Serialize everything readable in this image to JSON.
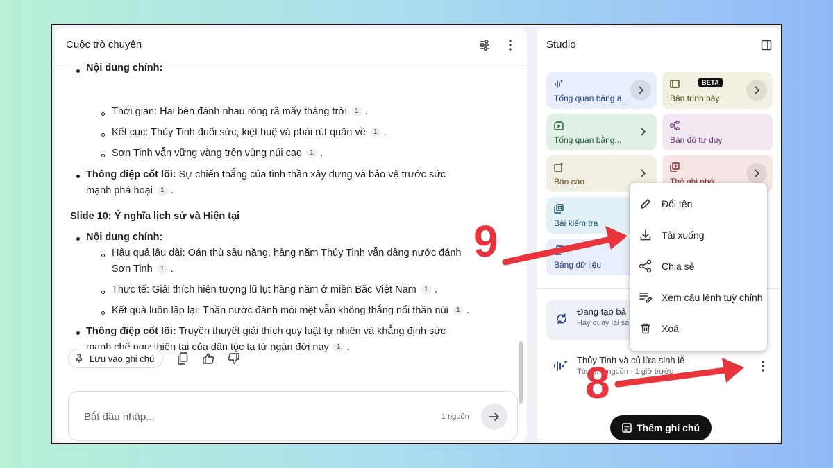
{
  "chat": {
    "title": "Cuộc trò chuyện",
    "lines": {
      "section_partial": "Nội dung chính:",
      "time": "Thời gian: Hai bên đánh nhau ròng rã mấy tháng trời",
      "outcome": "Kết cục: Thủy Tinh đuối sức, kiệt huệ và phải rút quân về",
      "son_tinh": "Sơn Tinh vẫn vững vàng trên vùng núi cao",
      "core_msg_label": "Thông điệp cốt lõi:",
      "core_msg_1": " Sự chiến thắng của tinh thần xây dựng và bảo vệ trước sức",
      "core_msg_1b": "mạnh phá hoại",
      "slide10": "Slide 10: Ý nghĩa lịch sử và Hiện tại",
      "content_label": "Nội dung chính:",
      "consequence": "Hậu quả lâu dài: Oán thù sâu nặng, hàng năm Thủy Tinh vẫn dâng nước đánh",
      "consequence_b": "Sơn Tinh",
      "reality": "Thực tế: Giải thích hiện tượng lũ lụt hàng năm ở miền Bắc Việt Nam",
      "repeat": "Kết quả luôn lặp lại: Thần nước đánh mỏi mệt vẫn không thắng nổi thần núi",
      "core_msg_2": " Truyền thuyết giải thích quy luật tự nhiên và khẳng định sức",
      "core_msg_2b": "mạnh chế ngự thiên tai của dân tộc ta từ ngàn đời nay",
      "cite": "1"
    },
    "save_note": "Lưu vào ghi chú",
    "composer_placeholder": "Bắt đầu nhập...",
    "source_count": "1 nguồn"
  },
  "studio": {
    "title": "Studio",
    "tiles": [
      {
        "label": "Tổng quan bằng â...",
        "bg": "#e8eefb",
        "fg": "#1f3a8a"
      },
      {
        "label": "Bản trình bày",
        "bg": "#f1f0e1",
        "fg": "#4a4a20",
        "badge": "BETA"
      },
      {
        "label": "Tổng quan bằng...",
        "bg": "#e2f1e6",
        "fg": "#1e5631"
      },
      {
        "label": "Bản đồ tư duy",
        "bg": "#f1e8f1",
        "fg": "#6a2c6a"
      },
      {
        "label": "Báo cáo",
        "bg": "#f1eee3",
        "fg": "#5c4a1e"
      },
      {
        "label": "Thẻ ghi nhớ",
        "bg": "#f7e6e6",
        "fg": "#8a1f1f"
      },
      {
        "label": "Bài kiểm tra",
        "bg": "#e1f1f7",
        "fg": "#1a4d66"
      },
      {
        "label": "Bảng dữ liệu",
        "bg": "#e8eefb",
        "fg": "#1f3a8a"
      }
    ],
    "generating_title": "Đang tạo bả",
    "generating_sub": "Hãy quay lại sa",
    "audio_title": "Thủy Tinh và củ lừa sinh lễ",
    "audio_sub": "Tóm... 1 nguồn · 1 giờ trước",
    "add_note": "Thêm ghi chú"
  },
  "menu": {
    "items": [
      "Đổi tên",
      "Tải xuống",
      "Chia sẻ",
      "Xem câu lệnh tuỳ chỉnh",
      "Xoá"
    ]
  },
  "annotations": {
    "step_a": "9",
    "step_b": "8",
    "color": "#e8353d"
  }
}
